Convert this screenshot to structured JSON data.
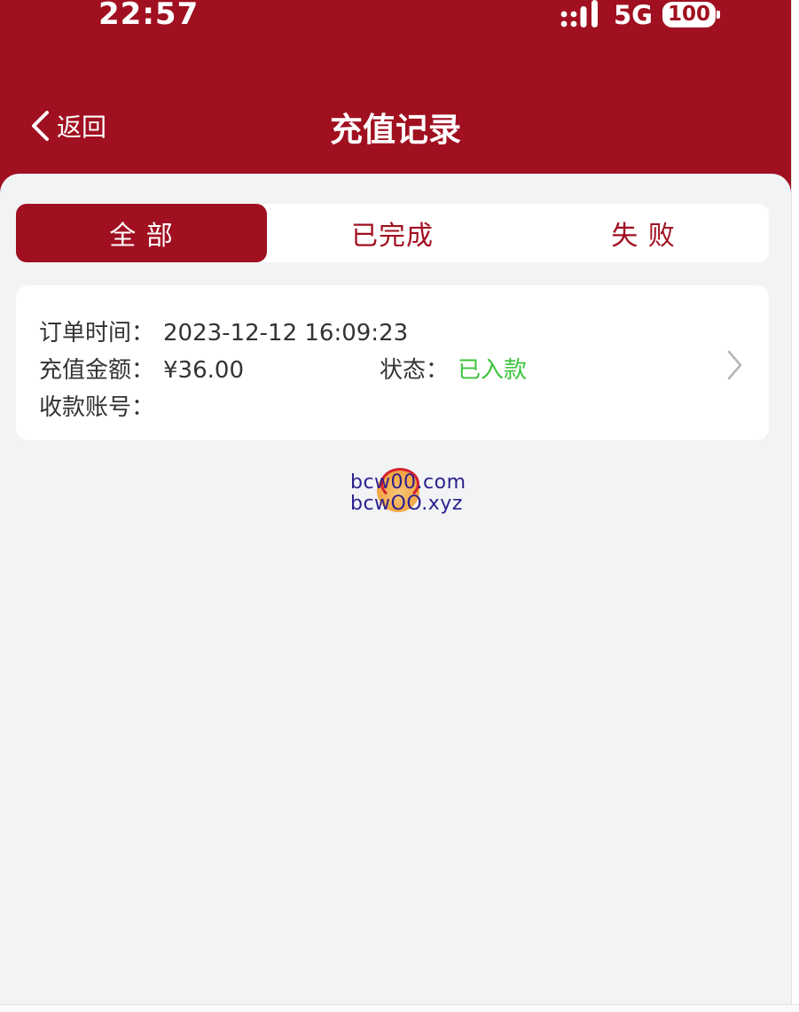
{
  "status_bar": {
    "time": "22:57",
    "network": "5G",
    "battery": "100"
  },
  "nav": {
    "back_label": "返回",
    "title": "充值记录"
  },
  "tabs": [
    {
      "label": "全 部",
      "active": true
    },
    {
      "label": "已完成",
      "active": false
    },
    {
      "label": "失 败",
      "active": false
    }
  ],
  "record": {
    "order_time_label": "订单时间：",
    "order_time": "2023-12-12 16:09:23",
    "amount_label": "充值金额：",
    "amount": "¥36.00",
    "status_label": "状态：",
    "status": "已入款",
    "account_label": "收款账号：",
    "account": ""
  },
  "watermark": {
    "line1": "bcw00.com",
    "line2": "bcwOO.xyz"
  },
  "colors": {
    "brand": "#a01020",
    "success": "#3cc43c",
    "background": "#f2f3f5"
  },
  "icons": {
    "back": "chevron-left-icon",
    "detail": "chevron-right-icon",
    "signal": "signal-icon",
    "battery": "battery-icon"
  }
}
